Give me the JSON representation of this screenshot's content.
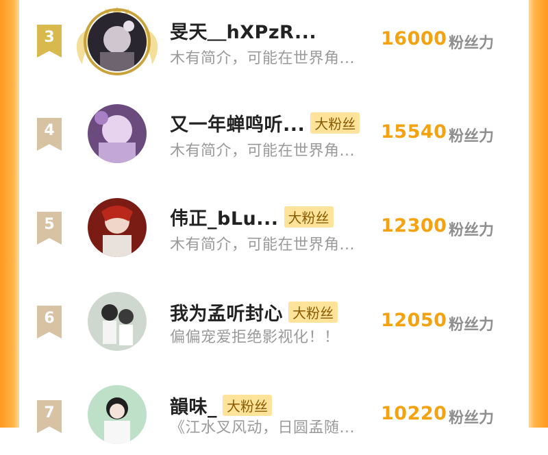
{
  "ranking": {
    "rows": [
      {
        "rank": "3",
        "name": "旻天＿hXPzR...",
        "badge": "",
        "bio": "木有简介，可能在世界角...",
        "score": "16000",
        "unit": "粉丝力"
      },
      {
        "rank": "4",
        "name": "又一年蝉鸣听...",
        "badge": "大粉丝",
        "bio": "木有简介，可能在世界角...",
        "score": "15540",
        "unit": "粉丝力"
      },
      {
        "rank": "5",
        "name": "伟正_bLu...",
        "badge": "大粉丝",
        "bio": "木有简介，可能在世界角...",
        "score": "12300",
        "unit": "粉丝力"
      },
      {
        "rank": "6",
        "name": "我为孟听封心",
        "badge": "大粉丝",
        "bio": "偏偏宠爱拒绝影视化！！",
        "score": "12050",
        "unit": "粉丝力"
      },
      {
        "rank": "7",
        "name": "韻味_",
        "badge": "大粉丝",
        "bio": "《江水叉风动，日圆孟随...",
        "score": "10220",
        "unit": "粉丝力"
      }
    ]
  },
  "colors": {
    "accent": "#f4a20f",
    "badge_bg": "#ffe39a",
    "side": "#ff9a1f"
  }
}
